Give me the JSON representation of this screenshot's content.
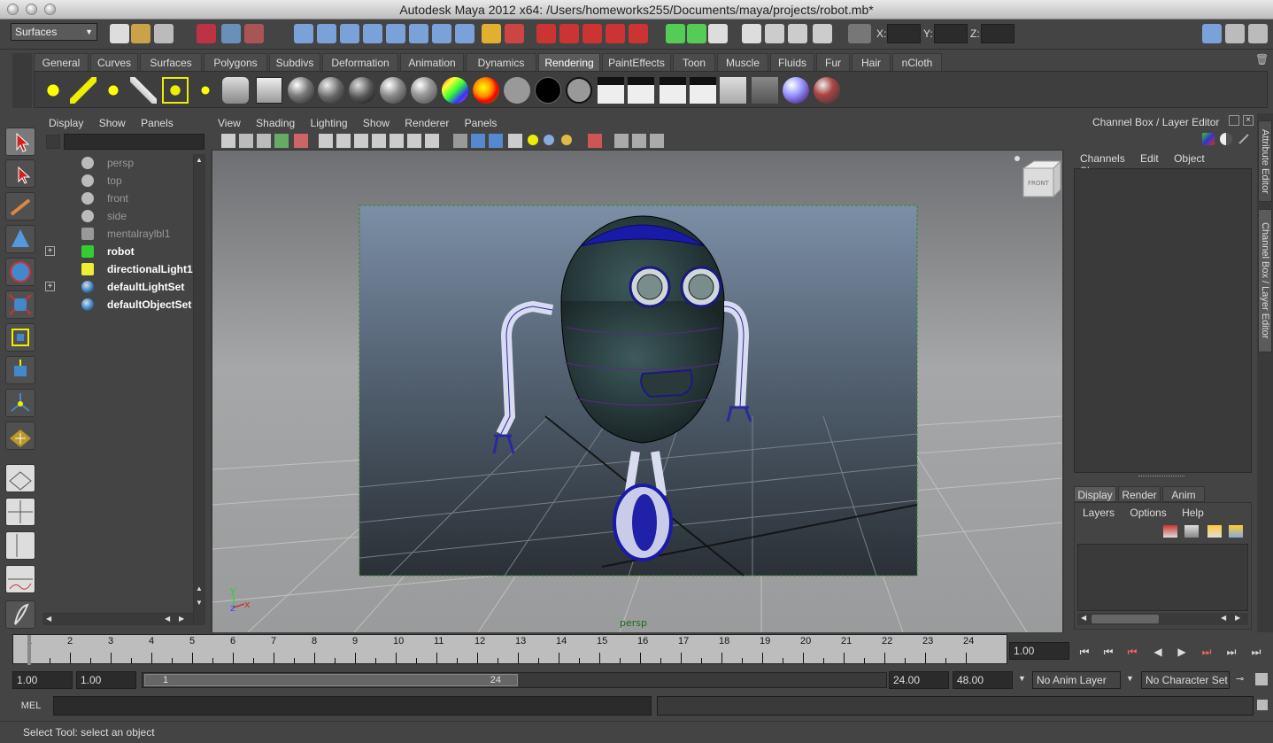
{
  "window": {
    "title": "Autodesk Maya 2012 x64: /Users/homeworks255/Documents/maya/projects/robot.mb*"
  },
  "statusline": {
    "menuset": "Surfaces",
    "x_label": "X:",
    "y_label": "Y:",
    "z_label": "Z:"
  },
  "shelf": {
    "tabs": [
      "General",
      "Curves",
      "Surfaces",
      "Polygons",
      "Subdivs",
      "Deformation",
      "Animation",
      "Dynamics",
      "Rendering",
      "PaintEffects",
      "Toon",
      "Muscle",
      "Fluids",
      "Fur",
      "Hair",
      "nCloth"
    ],
    "active_tab": "Rendering"
  },
  "outliner": {
    "menu": [
      "Display",
      "Show",
      "Panels"
    ],
    "items": [
      {
        "label": "persp",
        "icon": "camera-icon",
        "bold": false,
        "expand": false
      },
      {
        "label": "top",
        "icon": "camera-icon",
        "bold": false,
        "expand": false
      },
      {
        "label": "front",
        "icon": "camera-icon",
        "bold": false,
        "expand": false
      },
      {
        "label": "side",
        "icon": "camera-icon",
        "bold": false,
        "expand": false
      },
      {
        "label": "mentalraylbl1",
        "icon": "mentalray-icon",
        "bold": false,
        "expand": false
      },
      {
        "label": "robot",
        "icon": "transform-icon",
        "bold": true,
        "expand": true
      },
      {
        "label": "directionalLight1",
        "icon": "directional-light-icon",
        "bold": true,
        "expand": false
      },
      {
        "label": "defaultLightSet",
        "icon": "set-icon",
        "bold": true,
        "expand": true
      },
      {
        "label": "defaultObjectSet",
        "icon": "set-icon",
        "bold": true,
        "expand": false
      }
    ]
  },
  "viewport": {
    "menu": [
      "View",
      "Shading",
      "Lighting",
      "Show",
      "Renderer",
      "Panels"
    ],
    "camera_label": "persp",
    "viewcube_label": "FRONT",
    "axis": {
      "y": "y",
      "z": "z",
      "x": "x"
    }
  },
  "channelbox": {
    "title": "Channel Box / Layer Editor",
    "menu": [
      "Channels",
      "Edit",
      "Object",
      "Show"
    ],
    "layer_tabs": [
      "Display",
      "Render",
      "Anim"
    ],
    "layer_menu": [
      "Layers",
      "Options",
      "Help"
    ]
  },
  "sidetabs": [
    "Attribute Editor",
    "Channel Box / Layer Editor"
  ],
  "timeline": {
    "ticks": [
      "1",
      "2",
      "3",
      "4",
      "5",
      "6",
      "7",
      "8",
      "9",
      "10",
      "11",
      "12",
      "13",
      "14",
      "15",
      "16",
      "17",
      "18",
      "19",
      "20",
      "21",
      "22",
      "23",
      "24"
    ],
    "current_time": "1.00"
  },
  "range": {
    "start": "1.00",
    "playback_start": "1.00",
    "slider_min": "1",
    "slider_max": "24",
    "playback_end": "24.00",
    "end": "48.00",
    "anim_layer": "No Anim Layer",
    "character_set": "No Character Set"
  },
  "command": {
    "label": "MEL"
  },
  "helpline": {
    "text": "Select Tool: select an object"
  }
}
